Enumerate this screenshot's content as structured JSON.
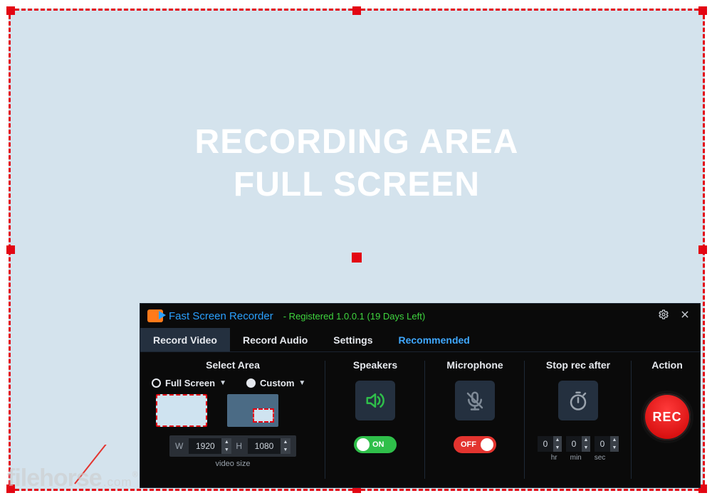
{
  "capture": {
    "label_line1": "RECORDING AREA",
    "label_line2": "FULL SCREEN"
  },
  "watermark": {
    "name": "filehorse",
    "tld": ".com"
  },
  "app": {
    "title": "Fast Screen Recorder",
    "status": "- Registered 1.0.0.1 (19 Days Left)"
  },
  "tabs": {
    "record_video": "Record Video",
    "record_audio": "Record Audio",
    "settings": "Settings",
    "recommended": "Recommended"
  },
  "columns": {
    "select_area": "Select Area",
    "speakers": "Speakers",
    "microphone": "Microphone",
    "stop_after": "Stop rec after",
    "action": "Action"
  },
  "select_area": {
    "full_screen": "Full Screen",
    "custom": "Custom",
    "w_label": "W",
    "h_label": "H",
    "width": "1920",
    "height": "1080",
    "note": "video size"
  },
  "speakers": {
    "state": "ON"
  },
  "microphone": {
    "state": "OFF"
  },
  "stop": {
    "hr": "0",
    "min": "0",
    "sec": "0",
    "hr_lbl": "hr",
    "min_lbl": "min",
    "sec_lbl": "sec"
  },
  "action": {
    "rec": "REC"
  }
}
